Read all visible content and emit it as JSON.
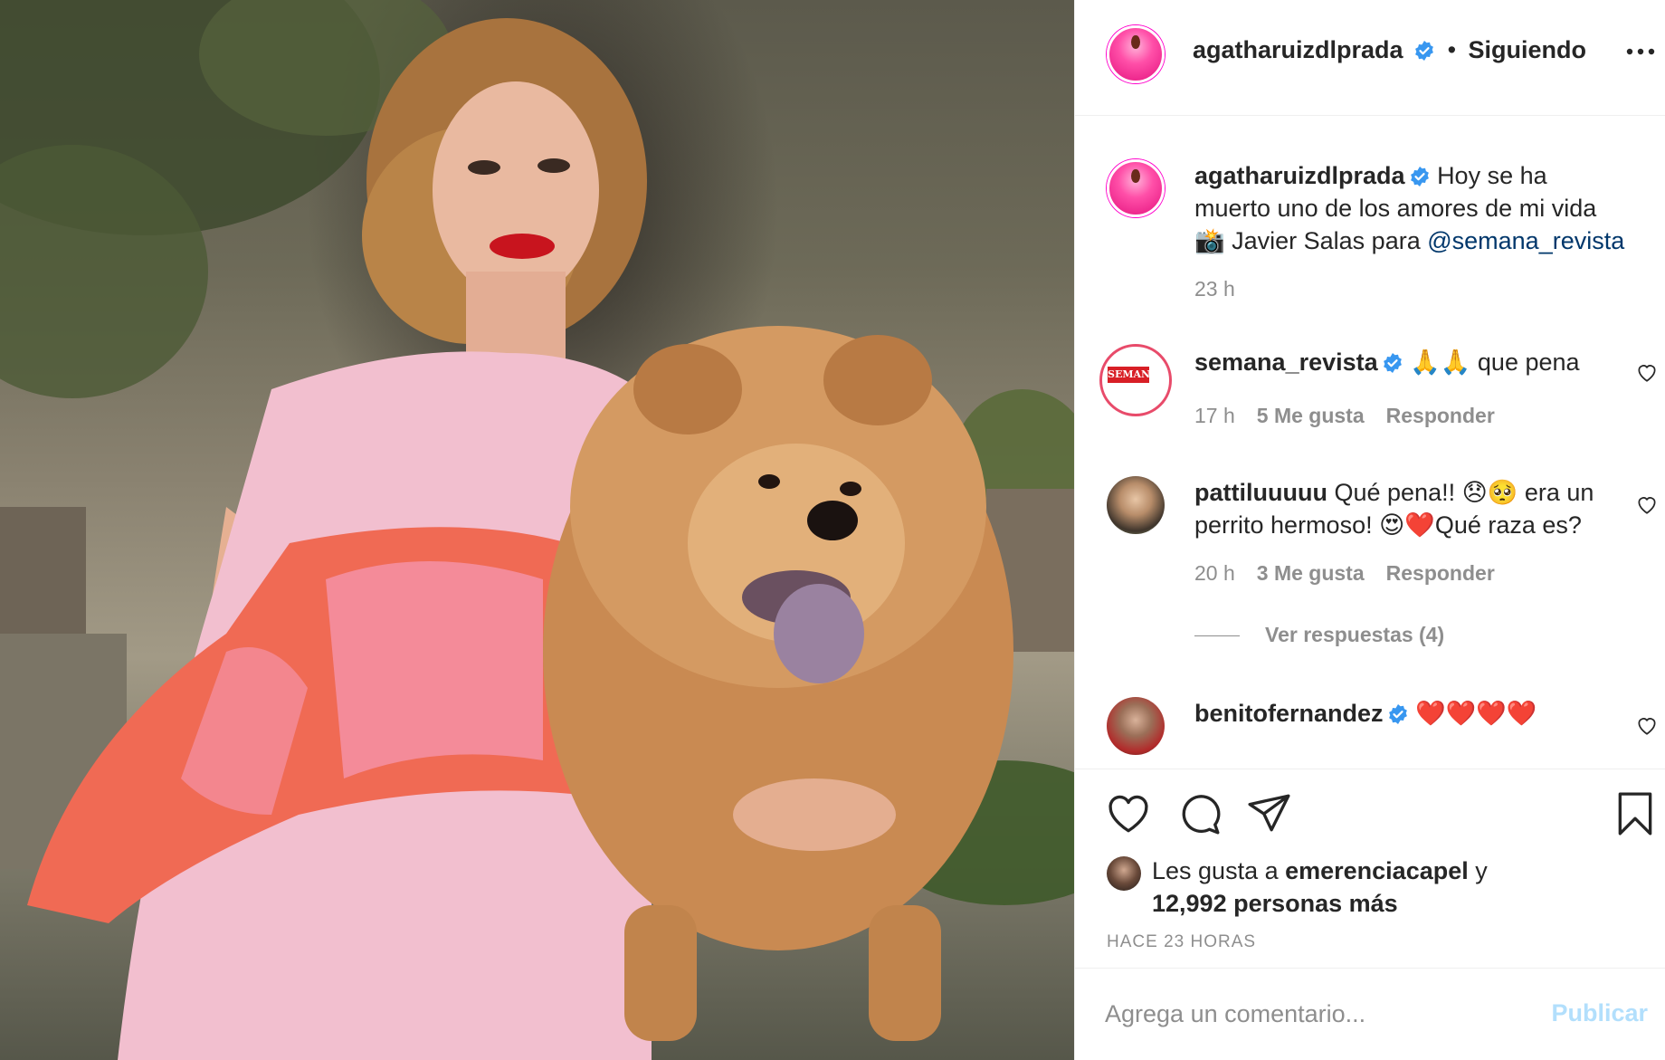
{
  "post": {
    "author": "agatharuizdlprada",
    "follow_separator": "•",
    "follow_status": "Siguiendo",
    "caption_pre": "Hoy se ha muerto uno de los amores de mi vida 📸 Javier Salas para ",
    "caption_mention": "@semana_revista",
    "caption_age": "23 h"
  },
  "comments": [
    {
      "user": "semana_revista",
      "text": "🙏🙏 que pena",
      "age": "17 h",
      "likes": "5 Me gusta",
      "reply": "Responder"
    },
    {
      "user": "pattiluuuuu",
      "text": "Qué pena!! 😞🥺 era un perrito hermoso! 😍❤️Qué raza es?",
      "age": "20 h",
      "likes": "3 Me gusta",
      "reply": "Responder",
      "view_replies": "Ver respuestas (4)"
    },
    {
      "user": "benitofernandez",
      "text": "❤️❤️❤️❤️"
    }
  ],
  "likes": {
    "prefix": "Les gusta a ",
    "user": "emerenciacapel",
    "suffix": " y",
    "count": "12,992 personas más"
  },
  "timestamp": "HACE 23 HORAS",
  "comment_box": {
    "placeholder": "Agrega un comentario...",
    "publish": "Publicar"
  },
  "icons": {
    "more": "more-options-icon",
    "like": "heart-icon",
    "comment": "comment-bubble-icon",
    "share": "paper-plane-icon",
    "save": "bookmark-icon",
    "verified": "verified-badge-icon"
  },
  "colors": {
    "verified": "#3897f0",
    "link": "#00376b",
    "muted": "#8e8e8e",
    "publish_disabled": "#b2dffc"
  }
}
